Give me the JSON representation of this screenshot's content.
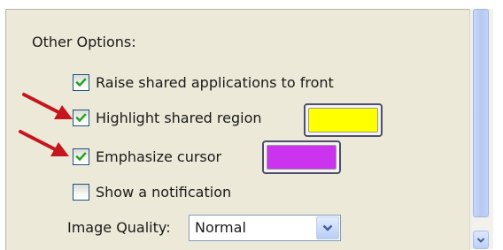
{
  "section": {
    "heading": "Other Options:"
  },
  "options": [
    {
      "label": "Raise shared applications to front",
      "checked": true
    },
    {
      "label": "Highlight shared region",
      "checked": true,
      "color": "#ffff00"
    },
    {
      "label": "Emphasize cursor",
      "checked": true,
      "color": "#cc33ee"
    },
    {
      "label": "Show a notification",
      "checked": false
    }
  ],
  "image_quality": {
    "label": "Image Quality:",
    "value": "Normal"
  },
  "annotations": {
    "arrow_color": "#c4161c"
  },
  "icons": {
    "checkmark": "check-icon",
    "dropdown": "chevron-down-icon",
    "scroll_down": "chevron-down-icon",
    "pointer": "red-arrow-icon"
  }
}
